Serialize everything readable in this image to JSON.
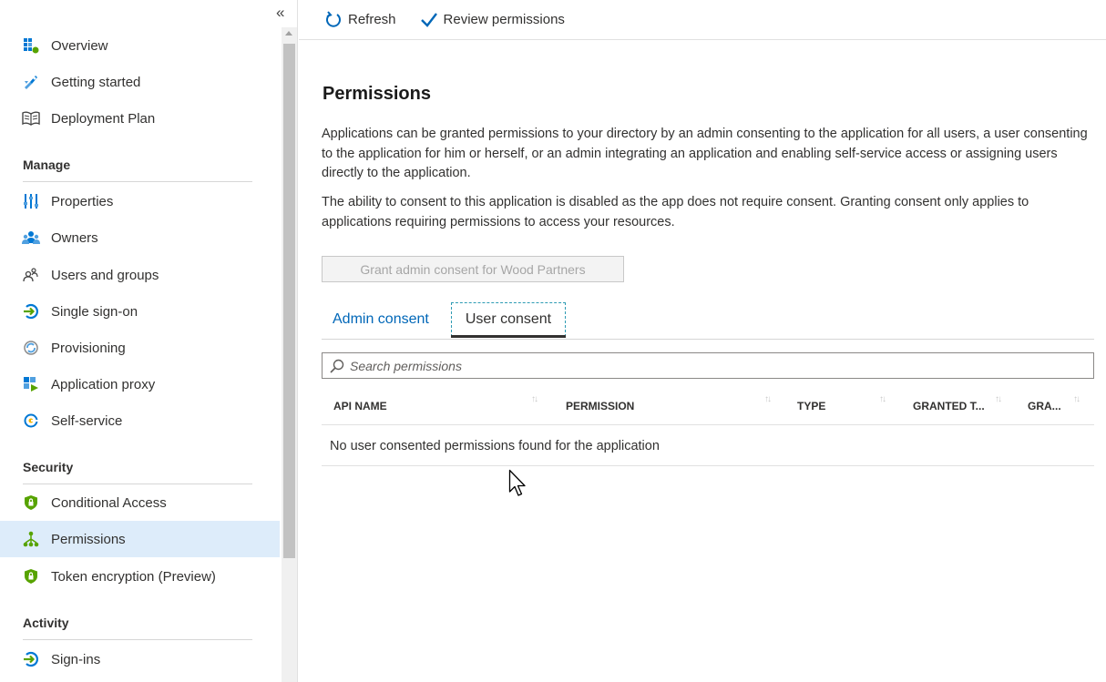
{
  "sidebar": {
    "collapse_glyph": "«",
    "items_top": [
      {
        "label": "Overview",
        "icon": "overview-grid-icon"
      },
      {
        "label": "Getting started",
        "icon": "rocket-icon"
      },
      {
        "label": "Deployment Plan",
        "icon": "book-icon"
      }
    ],
    "sections": [
      {
        "heading": "Manage",
        "items": [
          {
            "label": "Properties",
            "icon": "sliders-icon"
          },
          {
            "label": "Owners",
            "icon": "people-icon"
          },
          {
            "label": "Users and groups",
            "icon": "users-icon"
          },
          {
            "label": "Single sign-on",
            "icon": "sign-in-arrow-icon"
          },
          {
            "label": "Provisioning",
            "icon": "sync-icon"
          },
          {
            "label": "Application proxy",
            "icon": "app-proxy-icon"
          },
          {
            "label": "Self-service",
            "icon": "self-service-icon"
          }
        ]
      },
      {
        "heading": "Security",
        "items": [
          {
            "label": "Conditional Access",
            "icon": "shield-icon"
          },
          {
            "label": "Permissions",
            "icon": "permissions-tree-icon",
            "active": true
          },
          {
            "label": "Token encryption (Preview)",
            "icon": "shield-icon"
          }
        ]
      },
      {
        "heading": "Activity",
        "items": [
          {
            "label": "Sign-ins",
            "icon": "sign-in-arrow-icon"
          }
        ]
      }
    ]
  },
  "toolbar": {
    "refresh_label": "Refresh",
    "review_label": "Review permissions"
  },
  "main": {
    "title": "Permissions",
    "paragraph1": "Applications can be granted permissions to your directory by an admin consenting to the application for all users, a user consenting to the application for him or herself, or an admin integrating an application and enabling self-service access or assigning users directly to the application.",
    "paragraph2": "The ability to consent to this application is disabled as the app does not require consent. Granting consent only applies to applications requiring permissions to access your resources.",
    "grant_button": "Grant admin consent for Wood Partners",
    "tabs": {
      "admin": "Admin consent",
      "user": "User consent",
      "selected": "User consent"
    },
    "search_placeholder": "Search permissions",
    "columns": [
      "API NAME",
      "PERMISSION",
      "TYPE",
      "GRANTED T...",
      "GRA..."
    ],
    "empty_message": "No user consented permissions found for the application"
  },
  "colors": {
    "accent": "#0067b8",
    "active_nav_bg": "#ddecfa",
    "icon_blue": "#0078d4",
    "icon_green": "#57a300"
  }
}
